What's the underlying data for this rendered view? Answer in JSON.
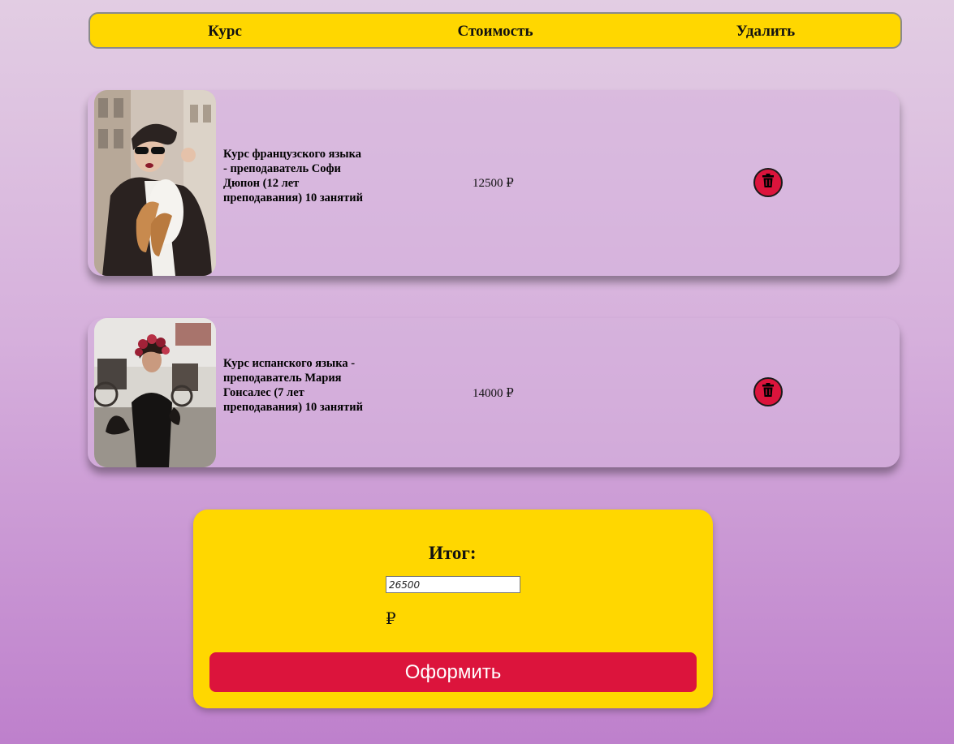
{
  "header": {
    "course_label": "Курс",
    "price_label": "Стоимость",
    "delete_label": "Удалить"
  },
  "cart": {
    "items": [
      {
        "title": "Курс французского языка - преподаватель Софи Дюпон (12 лет преподавания) 10 занятий",
        "price": "12500 ₽",
        "delete_icon": "trash-icon"
      },
      {
        "title": "Курс испанского языка - преподаватель Мария Гонсалес (7 лет преподавания) 10 занятий",
        "price": "14000 ₽",
        "delete_icon": "trash-icon"
      }
    ]
  },
  "summary": {
    "total_label": "Итог:",
    "total_value": "26500",
    "currency": "₽",
    "checkout_label": "Оформить"
  },
  "colors": {
    "accent_yellow": "#ffd700",
    "accent_red": "#dc143c"
  }
}
